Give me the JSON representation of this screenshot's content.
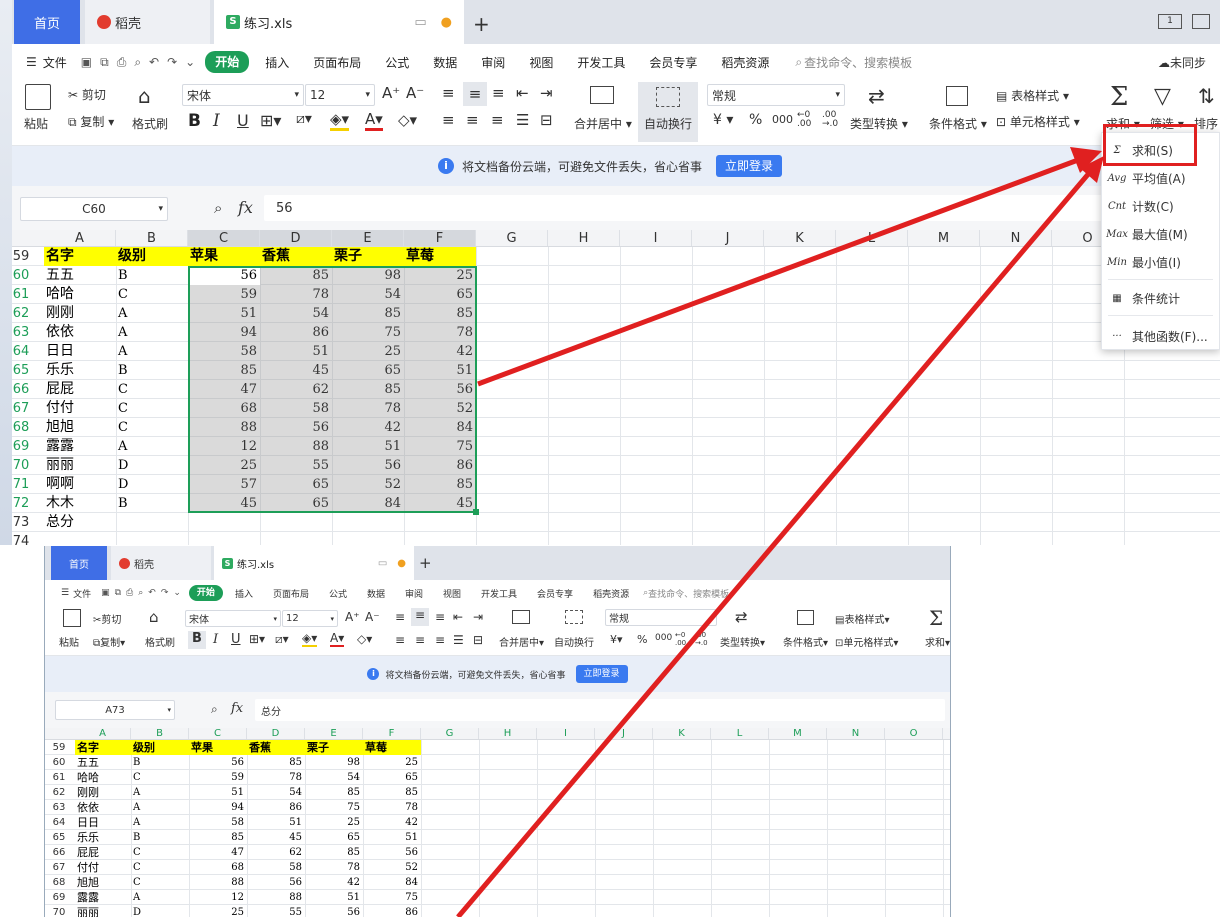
{
  "tabs": {
    "home": "首页",
    "daoke": "稻壳",
    "file": "练习.xls"
  },
  "topright": {
    "sync": "未同步",
    "pages": "1"
  },
  "menu": {
    "file": "文件",
    "items": [
      "开始",
      "插入",
      "页面布局",
      "公式",
      "数据",
      "审阅",
      "视图",
      "开发工具",
      "会员专享",
      "稻壳资源"
    ],
    "search": "查找命令、搜索模板"
  },
  "ribbon": {
    "paste": "粘贴",
    "cut": "剪切",
    "copy": "复制",
    "format_painter": "格式刷",
    "font": "宋体",
    "size": "12",
    "merge": "合并居中",
    "wrap": "自动换行",
    "number_format": "常规",
    "type_convert": "类型转换",
    "cond_format": "条件格式",
    "table_style": "表格样式",
    "cell_style": "单元格样式",
    "sum": "求和",
    "filter": "筛选",
    "sort": "排序",
    "currency": "¥",
    "percent": "%"
  },
  "notice": {
    "text": "将文档备份云端，可避免文件丢失，省心省事",
    "button": "立即登录"
  },
  "top_window": {
    "cell_ref": "C60",
    "formula": "56"
  },
  "bottom_window": {
    "cell_ref": "A73",
    "formula": "总分"
  },
  "fx": "fx",
  "columns": [
    "A",
    "B",
    "C",
    "D",
    "E",
    "F",
    "G",
    "H",
    "I",
    "J",
    "K",
    "L",
    "M",
    "N",
    "O"
  ],
  "header_row": {
    "num": "59",
    "cells": [
      "名字",
      "级别",
      "苹果",
      "香蕉",
      "栗子",
      "草莓"
    ]
  },
  "rows": [
    {
      "num": "60",
      "name": "五五",
      "level": "B",
      "v": [
        "56",
        "85",
        "98",
        "25"
      ]
    },
    {
      "num": "61",
      "name": "哈哈",
      "level": "C",
      "v": [
        "59",
        "78",
        "54",
        "65"
      ]
    },
    {
      "num": "62",
      "name": "刚刚",
      "level": "A",
      "v": [
        "51",
        "54",
        "85",
        "85"
      ]
    },
    {
      "num": "63",
      "name": "依依",
      "level": "A",
      "v": [
        "94",
        "86",
        "75",
        "78"
      ]
    },
    {
      "num": "64",
      "name": "日日",
      "level": "A",
      "v": [
        "58",
        "51",
        "25",
        "42"
      ]
    },
    {
      "num": "65",
      "name": "乐乐",
      "level": "B",
      "v": [
        "85",
        "45",
        "65",
        "51"
      ]
    },
    {
      "num": "66",
      "name": "屁屁",
      "level": "C",
      "v": [
        "47",
        "62",
        "85",
        "56"
      ]
    },
    {
      "num": "67",
      "name": "付付",
      "level": "C",
      "v": [
        "68",
        "58",
        "78",
        "52"
      ]
    },
    {
      "num": "68",
      "name": "旭旭",
      "level": "C",
      "v": [
        "88",
        "56",
        "42",
        "84"
      ]
    },
    {
      "num": "69",
      "name": "露露",
      "level": "A",
      "v": [
        "12",
        "88",
        "51",
        "75"
      ]
    },
    {
      "num": "70",
      "name": "丽丽",
      "level": "D",
      "v": [
        "25",
        "55",
        "56",
        "86"
      ]
    },
    {
      "num": "71",
      "name": "啊啊",
      "level": "D",
      "v": [
        "57",
        "65",
        "52",
        "85"
      ]
    },
    {
      "num": "72",
      "name": "木木",
      "level": "B",
      "v": [
        "45",
        "65",
        "84",
        "45"
      ]
    }
  ],
  "total_row": {
    "num": "73",
    "label": "总分"
  },
  "next_row": "74",
  "dropdown": [
    {
      "icon": "Σ",
      "label": "求和(S)"
    },
    {
      "icon": "Avg",
      "label": "平均值(A)"
    },
    {
      "icon": "Cnt",
      "label": "计数(C)"
    },
    {
      "icon": "Max",
      "label": "最大值(M)"
    },
    {
      "icon": "Min",
      "label": "最小值(I)"
    },
    {
      "icon": "▦",
      "label": "条件统计"
    },
    {
      "icon": "···",
      "label": "其他函数(F)..."
    }
  ],
  "colors": {
    "accent": "#1d9e58",
    "home_tab": "#3f6ee6",
    "annotation": "#e02020",
    "header_fill": "#ffff00"
  }
}
